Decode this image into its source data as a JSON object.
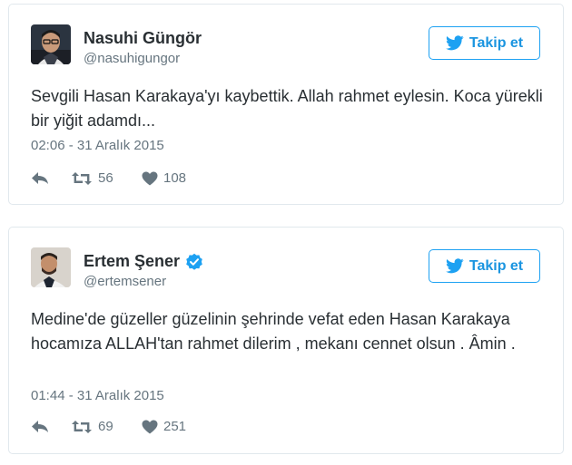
{
  "colors": {
    "twitter_blue": "#1da1f2",
    "name_text": "#292f33",
    "meta_text": "#66757f",
    "card_border": "#e1e8ed",
    "verified_badge": "#1da1f2"
  },
  "tweets": [
    {
      "author_name": "Nasuhi Güngör",
      "handle": "@nasuhigungor",
      "verified": false,
      "avatar_icon": "user-avatar",
      "follow_label": "Takip et",
      "text": "Sevgili Hasan Karakaya'yı kaybettik. Allah rahmet eylesin. Koca yürekli bir yiğit adamdı...",
      "timestamp": "02:06 - 31 Aralık 2015",
      "retweet_count": "56",
      "like_count": "108"
    },
    {
      "author_name": "Ertem Şener",
      "handle": "@ertemsener",
      "verified": true,
      "avatar_icon": "user-avatar",
      "follow_label": "Takip et",
      "text": "Medine'de güzeller güzelinin şehrinde vefat eden Hasan Karakaya hocamıza ALLAH'tan rahmet dilerim , mekanı cennet olsun . Âmin .",
      "timestamp": "01:44 - 31 Aralık 2015",
      "retweet_count": "69",
      "like_count": "251"
    }
  ]
}
